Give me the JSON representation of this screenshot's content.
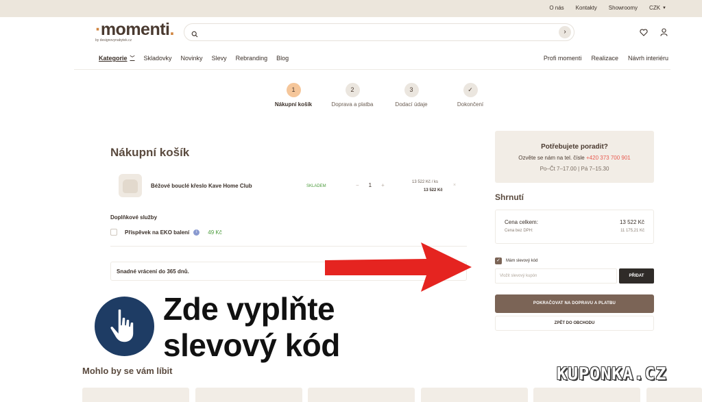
{
  "topbar": {
    "links": [
      "O nás",
      "Kontakty",
      "Showroomy"
    ],
    "currency": "CZK"
  },
  "logo": {
    "name": "momenti",
    "sub": "by designovynabytek.cz"
  },
  "search": {
    "placeholder": ""
  },
  "nav": {
    "items": [
      "Kategorie",
      "Skladovky",
      "Novinky",
      "Slevy",
      "Rebranding",
      "Blog"
    ],
    "right": [
      "Profi momenti",
      "Realizace",
      "Návrh interiéru"
    ]
  },
  "steps": [
    {
      "num": "1",
      "label": "Nákupní košík"
    },
    {
      "num": "2",
      "label": "Doprava a platba"
    },
    {
      "num": "3",
      "label": "Dodací údaje"
    },
    {
      "num": "✓",
      "label": "Dokončení"
    }
  ],
  "cart": {
    "title": "Nákupní košík",
    "item": {
      "name": "Béžové bouclé křeslo Kave Home Club",
      "stock": "SKLADEM",
      "qty": "1",
      "unit_price": "13 522 Kč / ks",
      "total_price": "13 522 Kč"
    },
    "addons_title": "Doplňkové služby",
    "addon": {
      "label": "Příspěvek na EKO balení",
      "price": "49 Kč"
    },
    "returns": "Snadné vrácení do 365 dnů."
  },
  "help": {
    "title": "Potřebujete poradit?",
    "phone_text": "Ozvěte se nám na tel. čísle",
    "phone": "+420 373 700 901",
    "hours": "Po–Čt 7–17.00 | Pá 7–15.30"
  },
  "summary": {
    "title": "Shrnutí",
    "total_label": "Cena celkem:",
    "total_value": "13 522 Kč",
    "net_label": "Cena bez DPH:",
    "net_value": "11 175,21 Kč"
  },
  "coupon": {
    "checkbox_label": "Mám slevový kód",
    "placeholder": "Vložit slevový kupón",
    "button": "PŘIDAT"
  },
  "buttons": {
    "continue": "POKRAČOVAT NA DOPRAVU A PLATBU",
    "back": "ZPĚT DO OBCHODU"
  },
  "overlay": {
    "line1": "Zde vyplňte",
    "line2": "slevový kód"
  },
  "recommend": {
    "title": "Mohlo by se vám líbit"
  },
  "watermark": "KUPONKA.CZ",
  "colors": {
    "accent": "#7b6456",
    "active_step": "#f5c69a",
    "arrow": "#e52420",
    "badge": "#1e3c64"
  }
}
